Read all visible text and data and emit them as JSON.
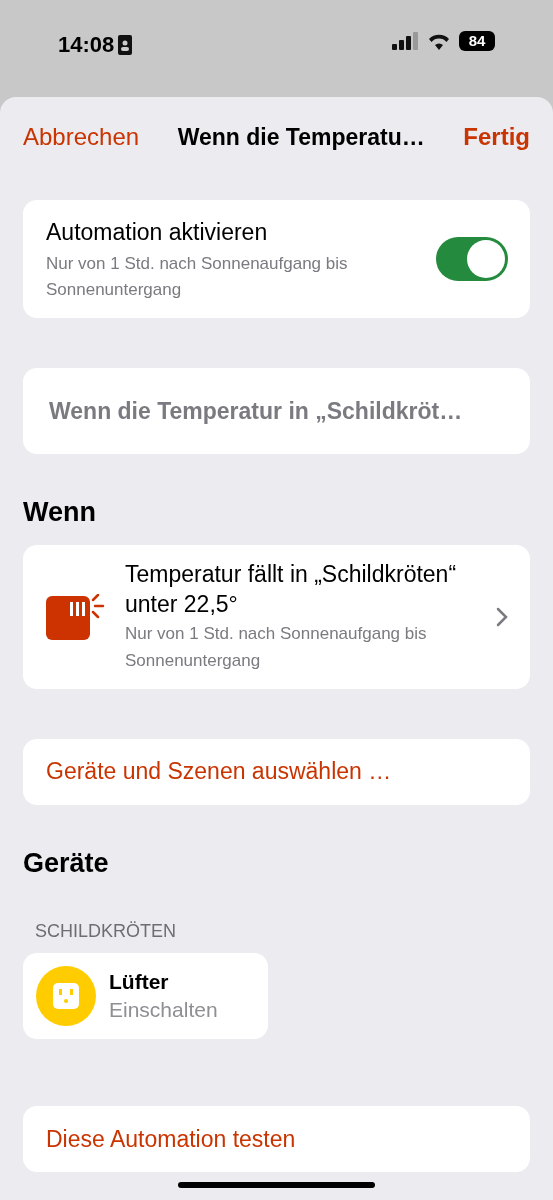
{
  "status_bar": {
    "time": "14:08",
    "battery": "84"
  },
  "nav": {
    "cancel": "Abbrechen",
    "title": "Wenn die Temperatu…",
    "done": "Fertig"
  },
  "activation": {
    "title": "Automation aktivieren",
    "subtitle": "Nur von 1 Std. nach Sonnenaufgang bis Sonnenuntergang",
    "on": true
  },
  "name_field": {
    "value": "Wenn die Temperatur in „Schildkröt…"
  },
  "trigger_section": {
    "heading": "Wenn",
    "title": "Temperatur fällt in „Schildkröten“ unter 22,5°",
    "subtitle": "Nur von 1 Std. nach Sonnenaufgang bis Sonnenuntergang"
  },
  "select_button": "Geräte und Szenen auswählen …",
  "devices_section": {
    "heading": "Geräte",
    "room": "SCHILDKRÖTEN",
    "devices": [
      {
        "name": "Lüfter",
        "action": "Einschalten"
      }
    ]
  },
  "test_button": "Diese Automation testen"
}
